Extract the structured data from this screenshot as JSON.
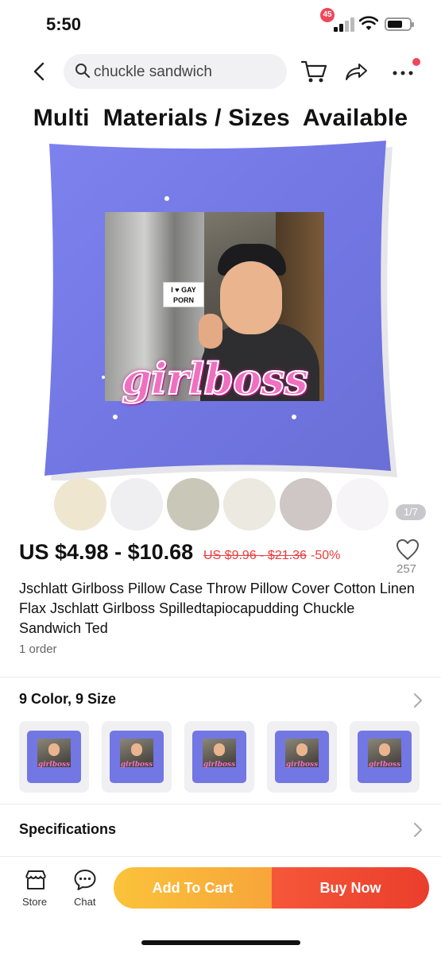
{
  "status_bar": {
    "time": "5:50"
  },
  "nav": {
    "search_query": "chuckle sandwich",
    "cart_count": "45",
    "icons": [
      "back-icon",
      "search-icon",
      "cart-icon",
      "share-icon",
      "more-icon"
    ]
  },
  "hero": {
    "banner_text": "Multi  Materials / Sizes  Available",
    "sign_text": "I ♥ GAY PORN",
    "overlay_text": "girlboss",
    "image_counter": "1/7"
  },
  "swatch_colors": [
    "#efe6d0",
    "#efeff1",
    "#c9c7b8",
    "#ece9e0",
    "#cfc6c6",
    "#f6f4f6"
  ],
  "price": {
    "range": "US $4.98 - $10.68",
    "original": "US $9.96 - $21.36",
    "discount": "-50%",
    "wishlist_count": "257"
  },
  "product": {
    "title": "Jschlatt Girlboss Pillow Case Throw Pillow Cover Cotton Linen Flax Jschlatt Girlboss Spilledtapiocapudding Chuckle Sandwich Ted",
    "orders": "1 order"
  },
  "variants": {
    "title": "9 Color, 9 Size",
    "thumb_text": "girlboss"
  },
  "specifications": {
    "title": "Specifications"
  },
  "bottom_bar": {
    "store_label": "Store",
    "chat_label": "Chat",
    "add_to_cart": "Add To Cart",
    "buy_now": "Buy Now"
  },
  "colors": {
    "accent_red": "#ee3b3b",
    "cart_orange": "#f8a53a",
    "buy_red": "#ea3e2c",
    "pillow_blue": "#7277e4"
  }
}
